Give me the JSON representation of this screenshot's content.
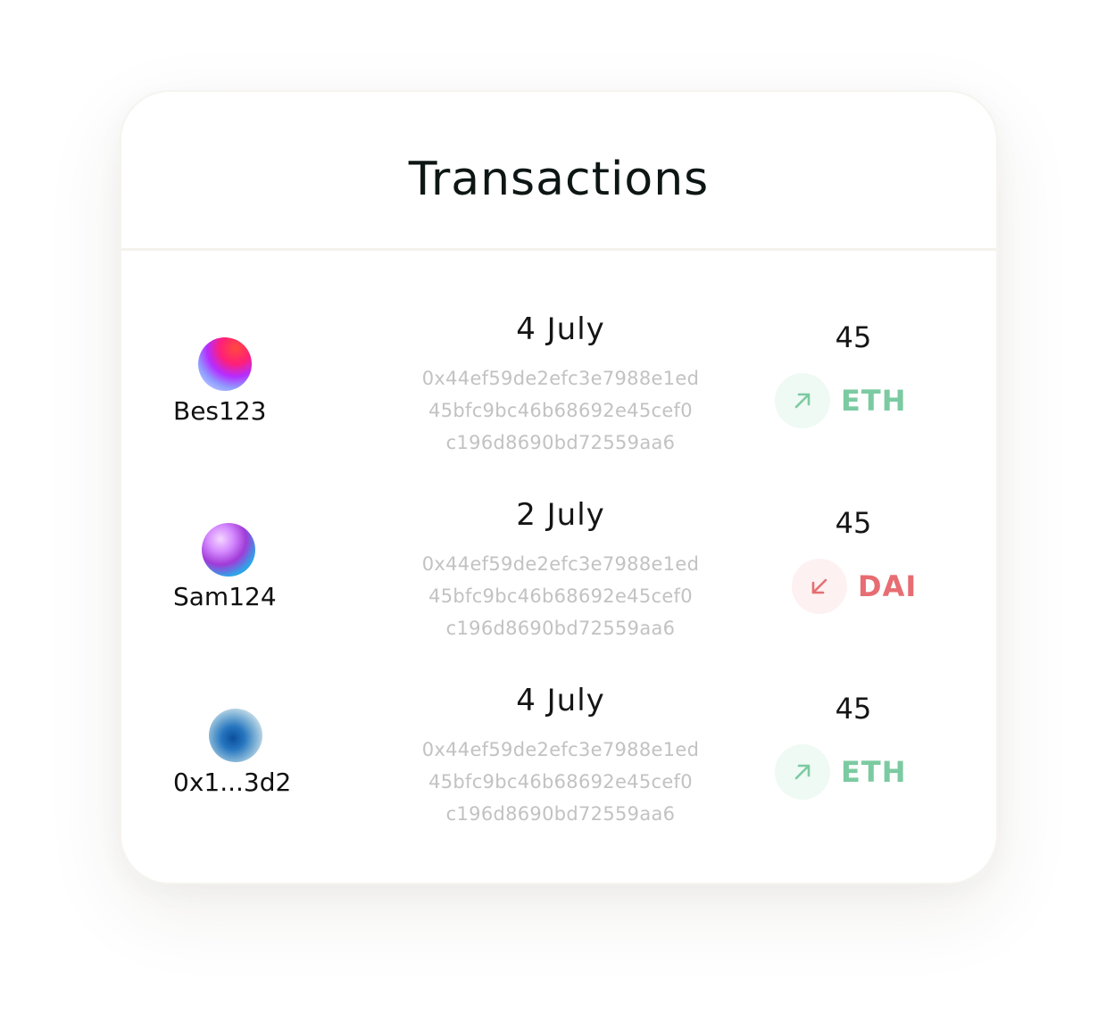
{
  "card": {
    "title": "Transactions"
  },
  "transactions": [
    {
      "user": "Bes123",
      "date": "4 July",
      "hash_lines": [
        "0x44ef59de2efc3e7988e1ed",
        "45bfc9bc46b68692e45cef0",
        "c196d8690bd72559aa6"
      ],
      "amount": "45",
      "token": "ETH",
      "direction": "outgoing",
      "direction_icon": "arrow-up-right-icon",
      "token_color": "#7ccaa1"
    },
    {
      "user": "Sam124",
      "date": "2 July",
      "hash_lines": [
        "0x44ef59de2efc3e7988e1ed",
        "45bfc9bc46b68692e45cef0",
        "c196d8690bd72559aa6"
      ],
      "amount": "45",
      "token": "DAI",
      "direction": "incoming",
      "direction_icon": "arrow-down-left-icon",
      "token_color": "#e76d72"
    },
    {
      "user": "0x1...3d2",
      "date": "4 July",
      "hash_lines": [
        "0x44ef59de2efc3e7988e1ed",
        "45bfc9bc46b68692e45cef0",
        "c196d8690bd72559aa6"
      ],
      "amount": "45",
      "token": "ETH",
      "direction": "outgoing",
      "direction_icon": "arrow-up-right-icon",
      "token_color": "#7ccaa1"
    }
  ]
}
